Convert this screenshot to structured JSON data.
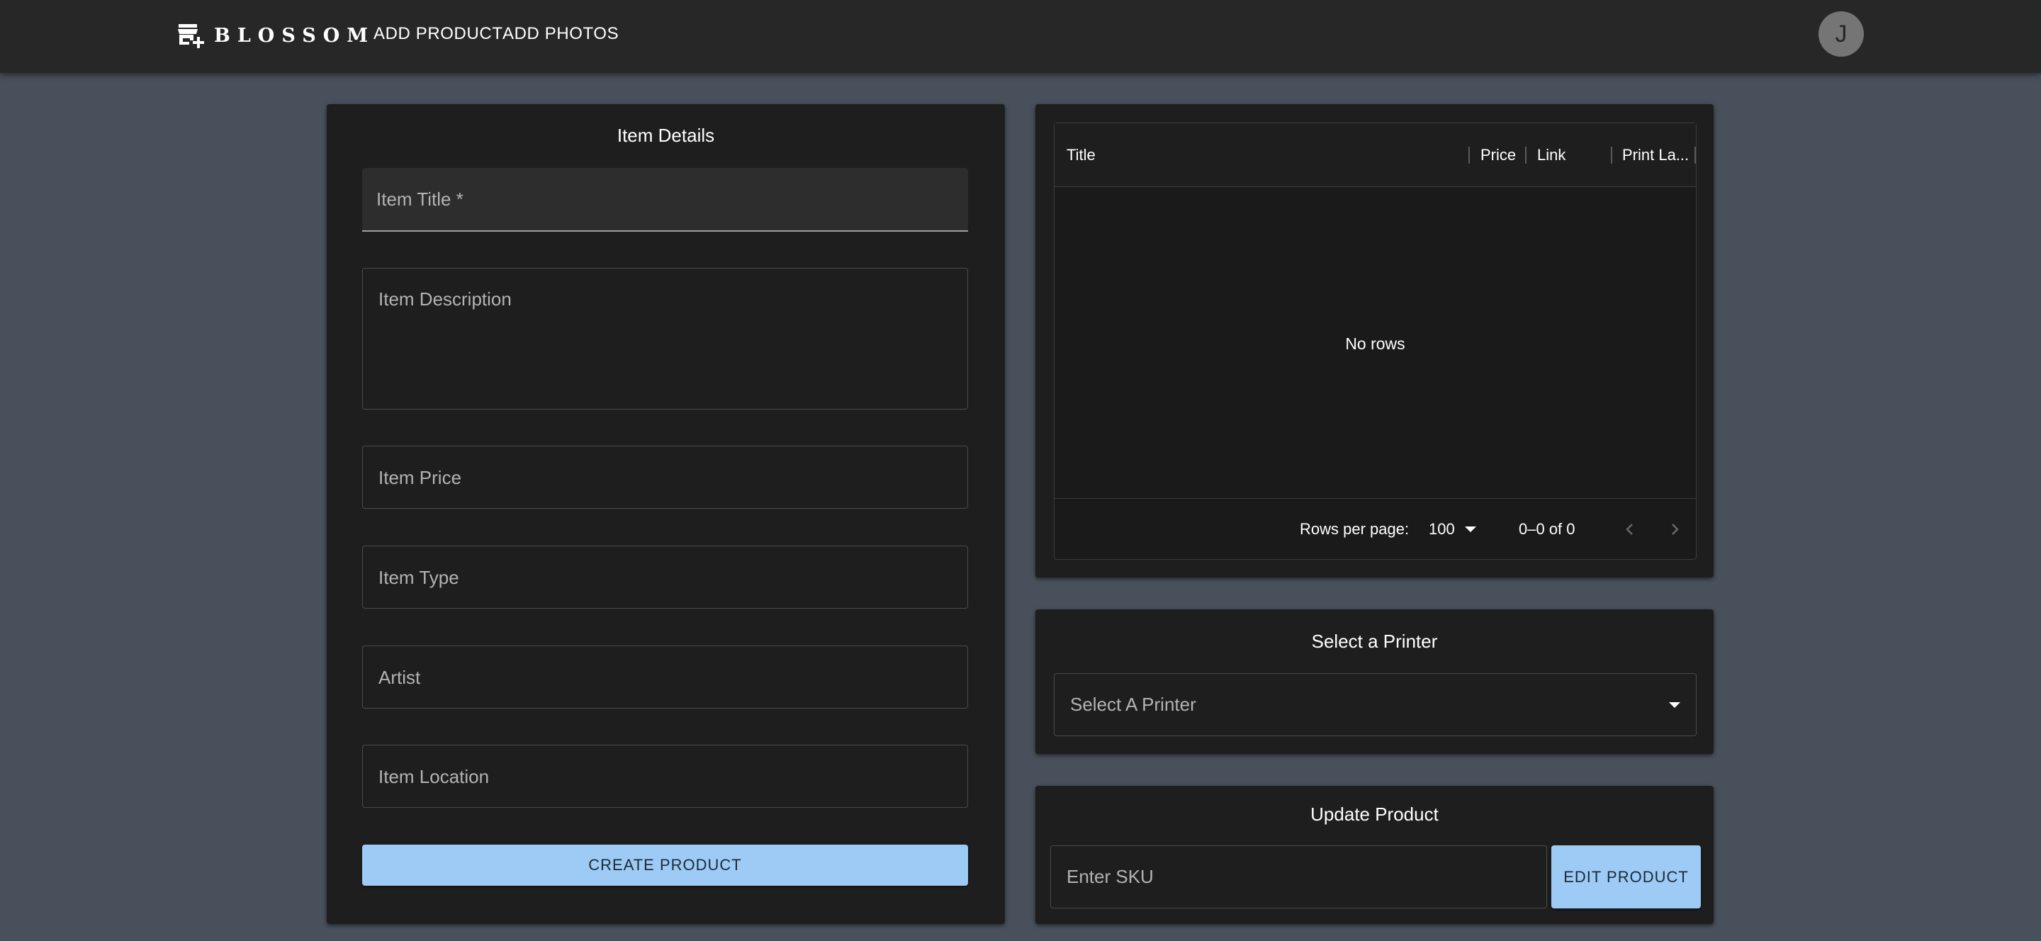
{
  "header": {
    "brand_name": "BLOSSOM",
    "logo_icon": "storefront-add-icon",
    "nav": [
      {
        "label": "ADD PRODUCT"
      },
      {
        "label": "ADD PHOTOS"
      }
    ],
    "avatar_initial": "J"
  },
  "item_details": {
    "title": "Item Details",
    "fields": {
      "title": "Item Title *",
      "description": "Item Description",
      "price": "Item Price",
      "type": "Item Type",
      "artist": "Artist",
      "location": "Item Location"
    },
    "create_label": "CREATE PRODUCT"
  },
  "products_table": {
    "columns": [
      "Title",
      "Price",
      "Link",
      "Print La..."
    ],
    "empty_text": "No rows",
    "rows_per_page_label": "Rows per page:",
    "rows_per_page_value": "100",
    "range_text": "0–0 of 0"
  },
  "printer": {
    "title": "Select a Printer",
    "select_label": "Select A Printer"
  },
  "update_product": {
    "title": "Update Product",
    "sku_placeholder": "Enter SKU",
    "edit_label": "EDIT PRODUCT"
  },
  "colors": {
    "background": "#48505b",
    "appbar": "#272727",
    "card": "#1e1e1e",
    "primary_button": "#9ecbf5"
  }
}
